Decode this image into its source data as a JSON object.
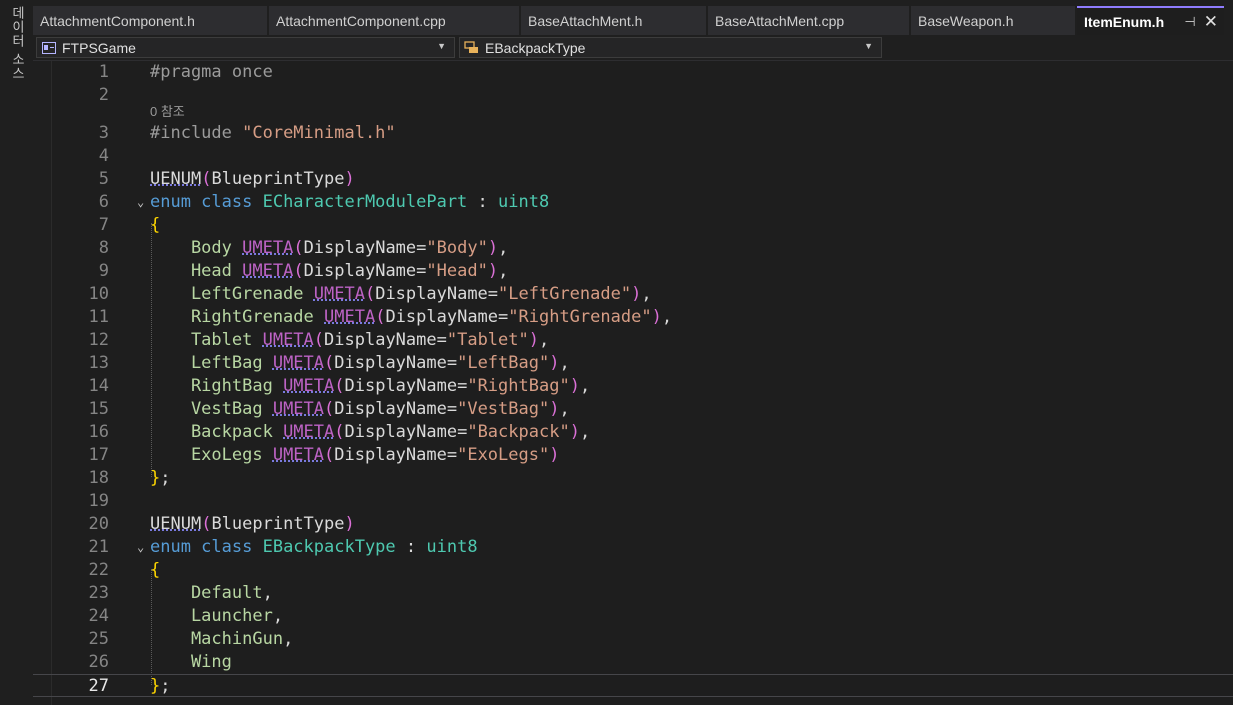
{
  "side_panel": {
    "label": "데이터 소스"
  },
  "tabs": [
    {
      "label": "AttachmentComponent.h"
    },
    {
      "label": "AttachmentComponent.cpp"
    },
    {
      "label": "BaseAttachMent.h"
    },
    {
      "label": "BaseAttachMent.cpp"
    },
    {
      "label": "BaseWeapon.h"
    },
    {
      "label": "ItemEnum.h",
      "active": true
    }
  ],
  "nav": {
    "project": "FTPSGame",
    "scope": "EBackpackType"
  },
  "editor": {
    "current_line": 27,
    "codelens": "0 참조",
    "lines": [
      {
        "n": "1",
        "tokens": [
          {
            "t": "#pragma once",
            "c": "pp"
          }
        ]
      },
      {
        "n": "2",
        "tokens": []
      },
      {
        "n": "3",
        "tokens": [
          {
            "t": "#include ",
            "c": "pp"
          },
          {
            "t": "\"CoreMinimal.h\"",
            "c": "str"
          }
        ]
      },
      {
        "n": "4",
        "tokens": []
      },
      {
        "n": "5",
        "tokens": [
          {
            "t": "UENUM",
            "c": "plain ul"
          },
          {
            "t": "(",
            "c": "paren"
          },
          {
            "t": "BlueprintType",
            "c": "plain"
          },
          {
            "t": ")",
            "c": "paren"
          }
        ]
      },
      {
        "n": "6",
        "fold": true,
        "tokens": [
          {
            "t": "enum class ",
            "c": "kw"
          },
          {
            "t": "ECharacterModulePart",
            "c": "type"
          },
          {
            "t": " : ",
            "c": "plain"
          },
          {
            "t": "uint8",
            "c": "type"
          }
        ]
      },
      {
        "n": "7",
        "tokens": [
          {
            "t": "{",
            "c": "brace"
          }
        ]
      },
      {
        "n": "8",
        "tokens": [
          {
            "t": "    Body ",
            "c": "enumv"
          },
          {
            "t": "UMETA",
            "c": "macro ul"
          },
          {
            "t": "(",
            "c": "paren"
          },
          {
            "t": "DisplayName=",
            "c": "plain"
          },
          {
            "t": "\"Body\"",
            "c": "str"
          },
          {
            "t": ")",
            "c": "paren"
          },
          {
            "t": ",",
            "c": "plain"
          }
        ]
      },
      {
        "n": "9",
        "tokens": [
          {
            "t": "    Head ",
            "c": "enumv"
          },
          {
            "t": "UMETA",
            "c": "macro ul"
          },
          {
            "t": "(",
            "c": "paren"
          },
          {
            "t": "DisplayName=",
            "c": "plain"
          },
          {
            "t": "\"Head\"",
            "c": "str"
          },
          {
            "t": ")",
            "c": "paren"
          },
          {
            "t": ",",
            "c": "plain"
          }
        ]
      },
      {
        "n": "10",
        "tokens": [
          {
            "t": "    LeftGrenade ",
            "c": "enumv"
          },
          {
            "t": "UMETA",
            "c": "macro ul"
          },
          {
            "t": "(",
            "c": "paren"
          },
          {
            "t": "DisplayName=",
            "c": "plain"
          },
          {
            "t": "\"LeftGrenade\"",
            "c": "str"
          },
          {
            "t": ")",
            "c": "paren"
          },
          {
            "t": ",",
            "c": "plain"
          }
        ]
      },
      {
        "n": "11",
        "tokens": [
          {
            "t": "    RightGrenade ",
            "c": "enumv"
          },
          {
            "t": "UMETA",
            "c": "macro ul"
          },
          {
            "t": "(",
            "c": "paren"
          },
          {
            "t": "DisplayName=",
            "c": "plain"
          },
          {
            "t": "\"RightGrenade\"",
            "c": "str"
          },
          {
            "t": ")",
            "c": "paren"
          },
          {
            "t": ",",
            "c": "plain"
          }
        ]
      },
      {
        "n": "12",
        "tokens": [
          {
            "t": "    Tablet ",
            "c": "enumv"
          },
          {
            "t": "UMETA",
            "c": "macro ul"
          },
          {
            "t": "(",
            "c": "paren"
          },
          {
            "t": "DisplayName=",
            "c": "plain"
          },
          {
            "t": "\"Tablet\"",
            "c": "str"
          },
          {
            "t": ")",
            "c": "paren"
          },
          {
            "t": ",",
            "c": "plain"
          }
        ]
      },
      {
        "n": "13",
        "tokens": [
          {
            "t": "    LeftBag ",
            "c": "enumv"
          },
          {
            "t": "UMETA",
            "c": "macro ul"
          },
          {
            "t": "(",
            "c": "paren"
          },
          {
            "t": "DisplayName=",
            "c": "plain"
          },
          {
            "t": "\"LeftBag\"",
            "c": "str"
          },
          {
            "t": ")",
            "c": "paren"
          },
          {
            "t": ",",
            "c": "plain"
          }
        ]
      },
      {
        "n": "14",
        "tokens": [
          {
            "t": "    RightBag ",
            "c": "enumv"
          },
          {
            "t": "UMETA",
            "c": "macro ul"
          },
          {
            "t": "(",
            "c": "paren"
          },
          {
            "t": "DisplayName=",
            "c": "plain"
          },
          {
            "t": "\"RightBag\"",
            "c": "str"
          },
          {
            "t": ")",
            "c": "paren"
          },
          {
            "t": ",",
            "c": "plain"
          }
        ]
      },
      {
        "n": "15",
        "tokens": [
          {
            "t": "    VestBag ",
            "c": "enumv"
          },
          {
            "t": "UMETA",
            "c": "macro ul"
          },
          {
            "t": "(",
            "c": "paren"
          },
          {
            "t": "DisplayName=",
            "c": "plain"
          },
          {
            "t": "\"VestBag\"",
            "c": "str"
          },
          {
            "t": ")",
            "c": "paren"
          },
          {
            "t": ",",
            "c": "plain"
          }
        ]
      },
      {
        "n": "16",
        "tokens": [
          {
            "t": "    Backpack ",
            "c": "enumv"
          },
          {
            "t": "UMETA",
            "c": "macro ul"
          },
          {
            "t": "(",
            "c": "paren"
          },
          {
            "t": "DisplayName=",
            "c": "plain"
          },
          {
            "t": "\"Backpack\"",
            "c": "str"
          },
          {
            "t": ")",
            "c": "paren"
          },
          {
            "t": ",",
            "c": "plain"
          }
        ]
      },
      {
        "n": "17",
        "tokens": [
          {
            "t": "    ExoLegs ",
            "c": "enumv"
          },
          {
            "t": "UMETA",
            "c": "macro ul"
          },
          {
            "t": "(",
            "c": "paren"
          },
          {
            "t": "DisplayName=",
            "c": "plain"
          },
          {
            "t": "\"ExoLegs\"",
            "c": "str"
          },
          {
            "t": ")",
            "c": "paren"
          }
        ]
      },
      {
        "n": "18",
        "tokens": [
          {
            "t": "}",
            "c": "brace"
          },
          {
            "t": ";",
            "c": "plain"
          }
        ]
      },
      {
        "n": "19",
        "tokens": []
      },
      {
        "n": "20",
        "tokens": [
          {
            "t": "UENUM",
            "c": "plain ul"
          },
          {
            "t": "(",
            "c": "paren"
          },
          {
            "t": "BlueprintType",
            "c": "plain"
          },
          {
            "t": ")",
            "c": "paren"
          }
        ]
      },
      {
        "n": "21",
        "fold": true,
        "tokens": [
          {
            "t": "enum class ",
            "c": "kw"
          },
          {
            "t": "EBackpackType",
            "c": "type"
          },
          {
            "t": " : ",
            "c": "plain"
          },
          {
            "t": "uint8",
            "c": "type"
          }
        ]
      },
      {
        "n": "22",
        "tokens": [
          {
            "t": "{",
            "c": "brace"
          }
        ]
      },
      {
        "n": "23",
        "tokens": [
          {
            "t": "    Default",
            "c": "enumv"
          },
          {
            "t": ",",
            "c": "plain"
          }
        ]
      },
      {
        "n": "24",
        "tokens": [
          {
            "t": "    Launcher",
            "c": "enumv"
          },
          {
            "t": ",",
            "c": "plain"
          }
        ]
      },
      {
        "n": "25",
        "tokens": [
          {
            "t": "    MachinGun",
            "c": "enumv"
          },
          {
            "t": ",",
            "c": "plain"
          }
        ]
      },
      {
        "n": "26",
        "tokens": [
          {
            "t": "    Wing",
            "c": "enumv"
          }
        ]
      },
      {
        "n": "27",
        "tokens": [
          {
            "t": "}",
            "c": "brace"
          },
          {
            "t": ";",
            "c": "plain"
          }
        ]
      }
    ]
  }
}
